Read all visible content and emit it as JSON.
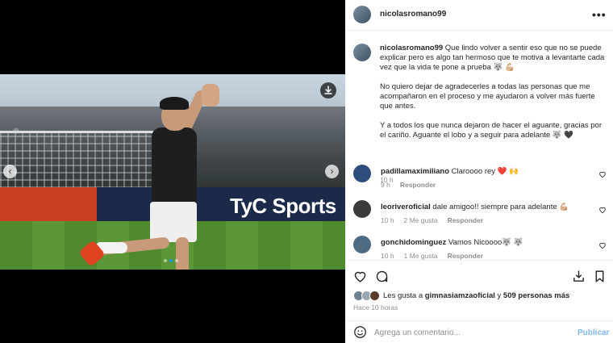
{
  "post": {
    "author": "nicolasromano99",
    "more_label": "•••",
    "caption_p1": "Que lindo volver a sentir eso que no se puede explicar pero es algo tan hermoso que te motiva a levantarte cada vez que la vida te pone a prueba 🐺 💪🏼",
    "caption_p2": "No quiero dejar de agradecerles a todas las personas que me acompañaron en el proceso y me ayudaron a volver más fuerte que antes.",
    "caption_p3": "Y a todos los que nunca dejaron de hacer el aguante, gracias por el cariño. Aguante el lobo y a seguir para adelante 🐺 🖤",
    "caption_time": "10 h",
    "board_text": "TyC Sports",
    "nav_prev": "‹",
    "nav_next": "›",
    "carousel_dots": 3,
    "carousel_active_index": 1
  },
  "comments": [
    {
      "user": "padillamaximiliano",
      "text": "Claroooo rey ❤️ 🙌",
      "time": "9 h",
      "likes": "",
      "reply_label": "Responder",
      "avatar_color": "#2e4d7a"
    },
    {
      "user": "leoriveroficial",
      "text": "dale amigoo!! siempre para adelante 💪🏼",
      "time": "10 h",
      "likes": "2 Me gusta",
      "reply_label": "Responder",
      "avatar_color": "#3a3a3a"
    },
    {
      "user": "gonchidominguez",
      "text": "Vamos Nicoooo🐺 🐺",
      "time": "10 h",
      "likes": "1 Me gusta",
      "reply_label": "Responder",
      "avatar_color": "#4f6b82"
    }
  ],
  "likes": {
    "prefix": "Les gusta a",
    "user": "gimnasiamzaoficial",
    "connector": "y",
    "others": "509 personas más"
  },
  "timestamp": "Hace 10 horas",
  "comment_box": {
    "placeholder": "Agrega un comentario...",
    "publish_label": "Publicar"
  },
  "colors": {
    "link_blue": "#0095f6",
    "publish_disabled": "#7fb8f0",
    "meta_gray": "#8e8e8e",
    "heart_red": "#ed4956"
  }
}
